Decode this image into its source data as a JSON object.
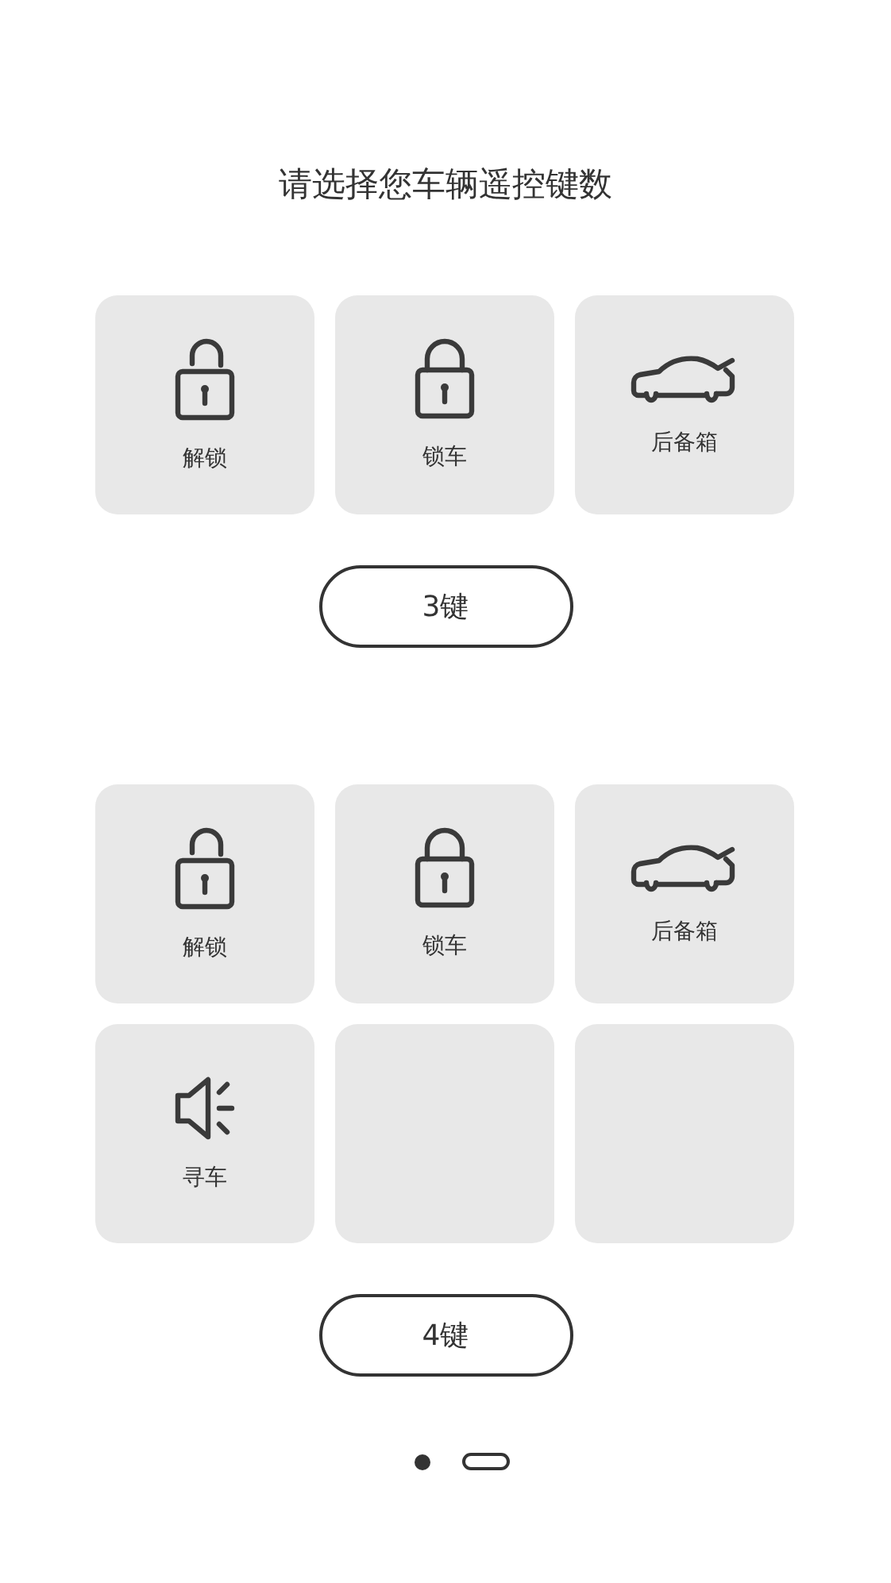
{
  "title": "请选择您车辆遥控键数",
  "options": [
    {
      "keys": [
        {
          "kind": "unlock",
          "label": "解锁"
        },
        {
          "kind": "lock",
          "label": "锁车"
        },
        {
          "kind": "trunk",
          "label": "后备箱"
        }
      ],
      "button": "3键"
    },
    {
      "keys": [
        {
          "kind": "unlock",
          "label": "解锁"
        },
        {
          "kind": "lock",
          "label": "锁车"
        },
        {
          "kind": "trunk",
          "label": "后备箱"
        },
        {
          "kind": "horn",
          "label": "寻车"
        },
        {
          "kind": "empty"
        },
        {
          "kind": "empty"
        }
      ],
      "button": "4键"
    }
  ],
  "pager": [
    {
      "selected": false
    },
    {
      "selected": true
    }
  ]
}
